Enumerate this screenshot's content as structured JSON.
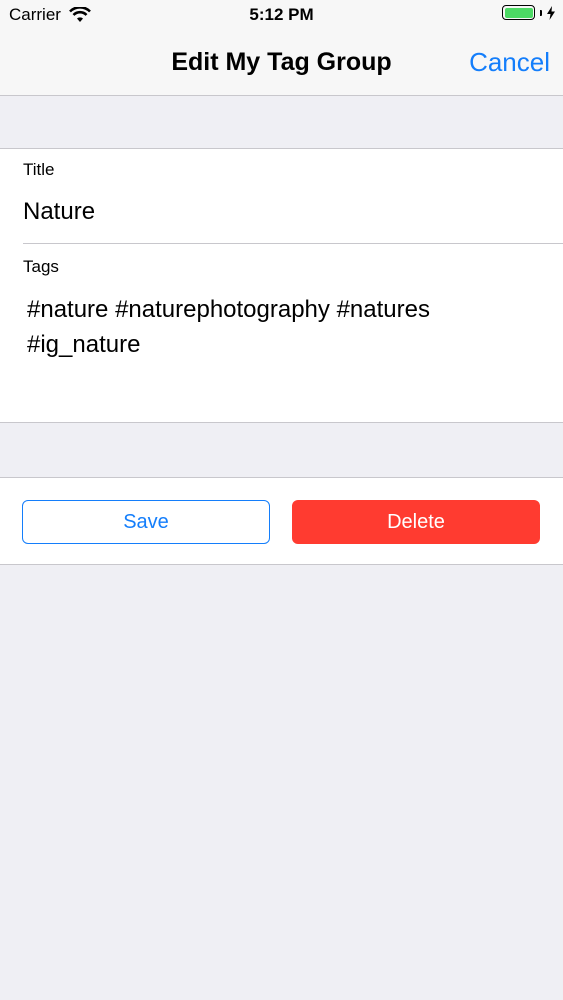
{
  "status_bar": {
    "carrier": "Carrier",
    "time": "5:12 PM",
    "icons": [
      "wifi-icon",
      "battery-icon",
      "charging-bolt-icon"
    ],
    "battery_color": "#4cd964"
  },
  "nav": {
    "title": "Edit My Tag Group",
    "cancel_label": "Cancel",
    "accent_color": "#147efb"
  },
  "form": {
    "title_label": "Title",
    "title_value": "Nature",
    "tags_label": "Tags",
    "tags_value": "#nature #naturephotography #natures #ig_nature"
  },
  "actions": {
    "save_label": "Save",
    "delete_label": "Delete",
    "delete_color": "#ff3b30"
  }
}
